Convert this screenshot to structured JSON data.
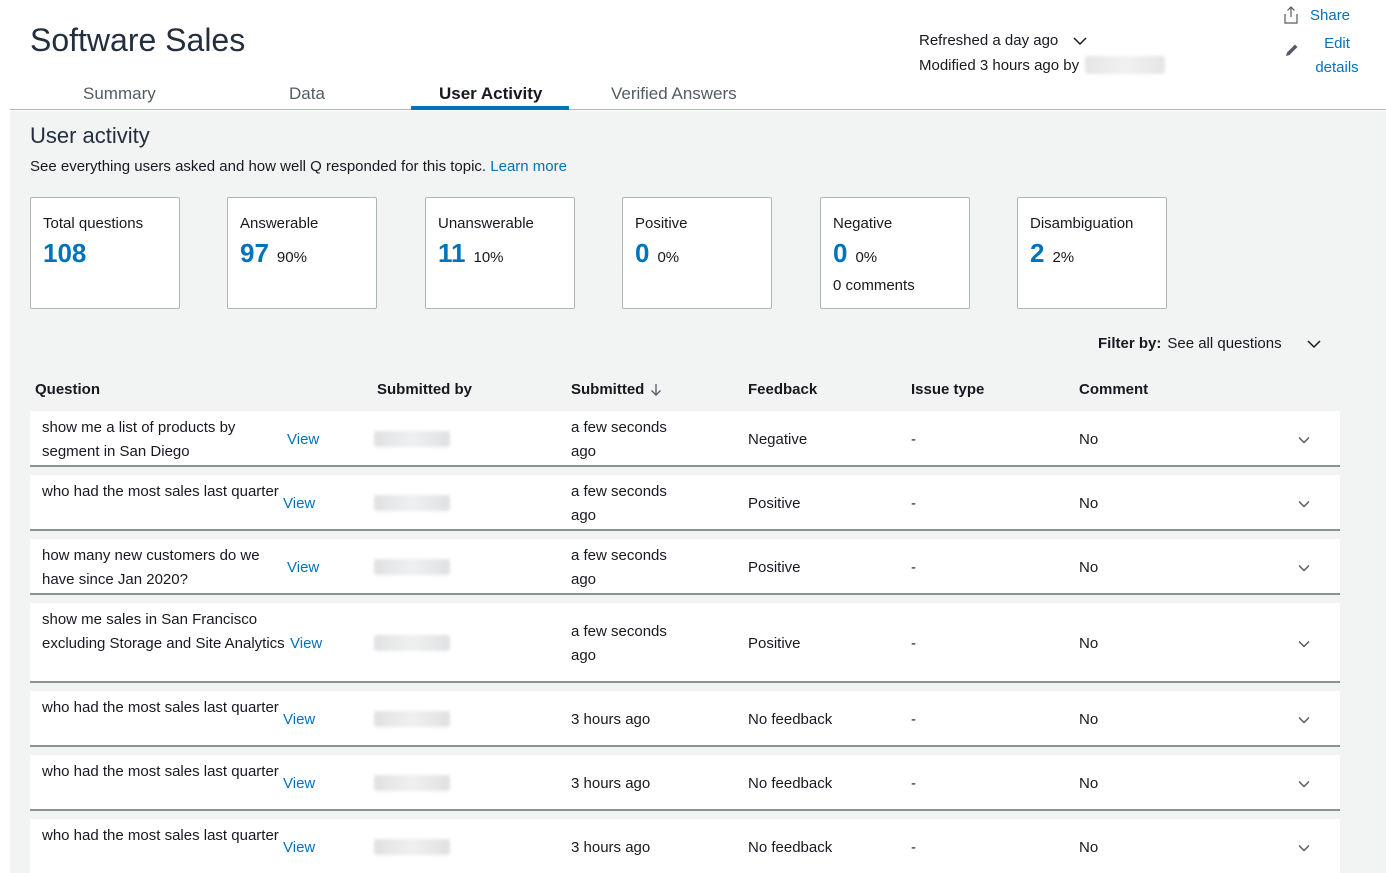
{
  "header": {
    "title": "Software Sales",
    "refreshed": "Refreshed a day ago",
    "modified": "Modified 3 hours ago by",
    "share_label": "Share",
    "edit_label": "Edit details"
  },
  "tabs": [
    {
      "label": "Summary",
      "active": false
    },
    {
      "label": "Data",
      "active": false
    },
    {
      "label": "User Activity",
      "active": true
    },
    {
      "label": "Verified Answers",
      "active": false
    }
  ],
  "section": {
    "title": "User activity",
    "description": "See everything users asked and how well Q responded for this topic.",
    "learn_more": "Learn more"
  },
  "stats": [
    {
      "label": "Total questions",
      "value": "108",
      "pct": ""
    },
    {
      "label": "Answerable",
      "value": "97",
      "pct": "90%"
    },
    {
      "label": "Unanswerable",
      "value": "11",
      "pct": "10%"
    },
    {
      "label": "Positive",
      "value": "0",
      "pct": "0%"
    },
    {
      "label": "Negative",
      "value": "0",
      "pct": "0%",
      "extra": "0 comments"
    },
    {
      "label": "Disambiguation",
      "value": "2",
      "pct": "2%"
    }
  ],
  "filter": {
    "label": "Filter by:",
    "value": "See all questions"
  },
  "table": {
    "columns": [
      "Question",
      "Submitted by",
      "Submitted",
      "Feedback",
      "Issue type",
      "Comment"
    ],
    "view_label": "View",
    "rows": [
      {
        "question": "show me a list of products by segment in San Diego",
        "submitted": "a few seconds ago",
        "feedback": "Negative",
        "issue": "-",
        "comment": "No"
      },
      {
        "question": "who had the most sales last quarter",
        "submitted": "a few seconds ago",
        "feedback": "Positive",
        "issue": "-",
        "comment": "No"
      },
      {
        "question": "how many new customers do we have since Jan 2020?",
        "submitted": "a few seconds ago",
        "feedback": "Positive",
        "issue": "-",
        "comment": "No"
      },
      {
        "question": "show me sales in San Francisco excluding Storage and Site Analytics",
        "submitted": "a few seconds ago",
        "feedback": "Positive",
        "issue": "-",
        "comment": "No"
      },
      {
        "question": "who had the most sales last quarter",
        "submitted": "3 hours ago",
        "feedback": "No feedback",
        "issue": "-",
        "comment": "No"
      },
      {
        "question": "who had the most sales last quarter",
        "submitted": "3 hours ago",
        "feedback": "No feedback",
        "issue": "-",
        "comment": "No"
      },
      {
        "question": "who had the most sales last quarter",
        "submitted": "3 hours ago",
        "feedback": "No feedback",
        "issue": "-",
        "comment": "No"
      }
    ]
  },
  "colors": {
    "accent": "#0073bb",
    "background": "#f2f3f3",
    "text": "#16191f"
  }
}
